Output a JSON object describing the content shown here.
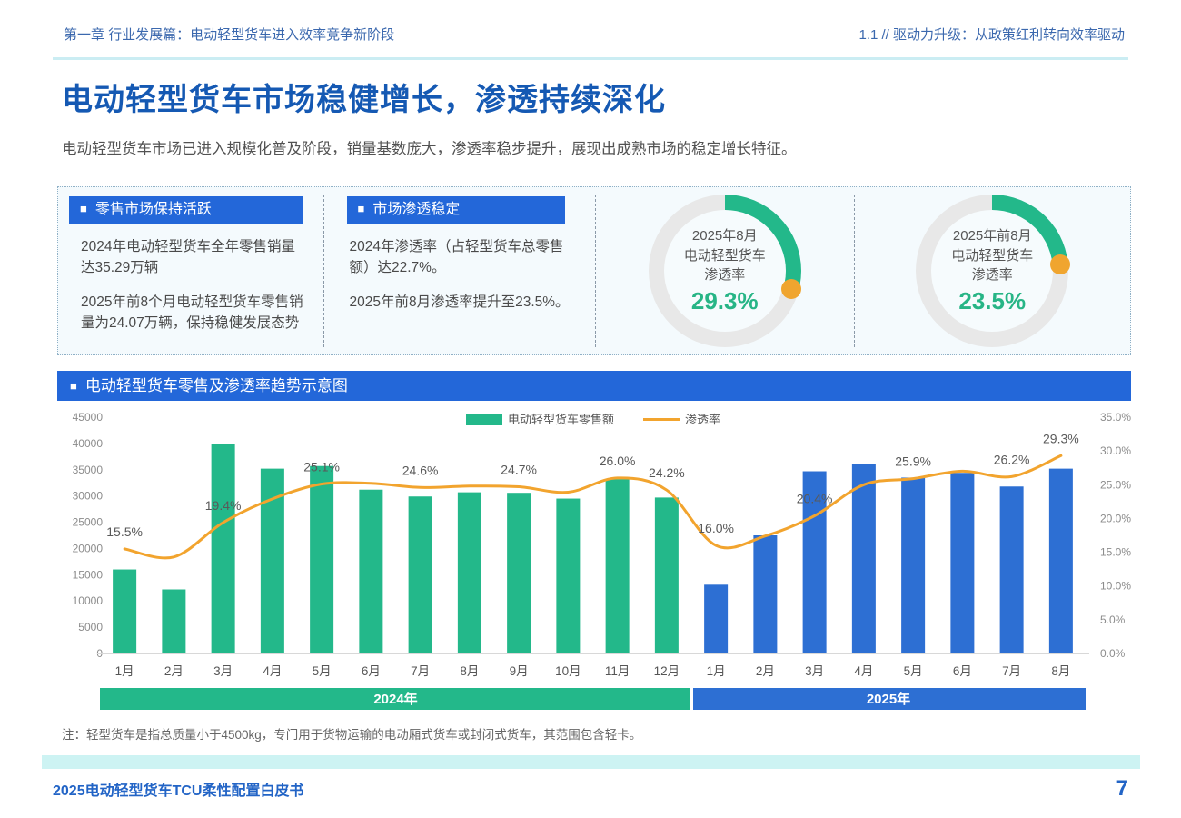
{
  "header": {
    "left": "第一章  行业发展篇：电动轻型货车进入效率竞争新阶段",
    "right": "1.1 // 驱动力升级：从政策红利转向效率驱动"
  },
  "page": {
    "title": "电动轻型货车市场稳健增长，渗透持续深化",
    "subtitle": "电动轻型货车市场已进入规模化普及阶段，销量基数庞大，渗透率稳步提升，展现出成熟市场的稳定增长特征。"
  },
  "cards": [
    {
      "bullet": "■",
      "title": "零售市场保持活跃",
      "paragraphs": [
        "2024年电动轻型货车全年零售销量达35.29万辆",
        "2025年前8个月电动轻型货车零售销量为24.07万辆，保持稳健发展态势"
      ]
    },
    {
      "bullet": "■",
      "title": "市场渗透稳定",
      "paragraphs": [
        "2024年渗透率（占轻型货车总零售额）达22.7%。",
        "2025年前8月渗透率提升至23.5%。"
      ]
    }
  ],
  "donuts": [
    {
      "label_lines": [
        "2025年8月",
        "电动轻型货车",
        "渗透率"
      ],
      "value": "29.3%",
      "percent": 29.3
    },
    {
      "label_lines": [
        "2025年前8月",
        "电动轻型货车",
        "渗透率"
      ],
      "value": "23.5%",
      "percent": 23.5
    }
  ],
  "chart_header": {
    "bullet": "■",
    "title": "电动轻型货车零售及渗透率趋势示意图"
  },
  "chart_data": {
    "type": "bar+line",
    "title": "电动轻型货车零售及渗透率趋势示意图",
    "categories": [
      "1月",
      "2月",
      "3月",
      "4月",
      "5月",
      "6月",
      "7月",
      "8月",
      "9月",
      "10月",
      "11月",
      "12月",
      "1月",
      "2月",
      "3月",
      "4月",
      "5月",
      "6月",
      "7月",
      "8月"
    ],
    "year_groups": [
      {
        "label": "2024年",
        "start": 0,
        "end": 11
      },
      {
        "label": "2025年",
        "start": 12,
        "end": 19
      }
    ],
    "series": [
      {
        "name": "电动轻型货车零售额",
        "type": "bar",
        "axis": "left",
        "values": [
          16000,
          12200,
          39900,
          35200,
          35700,
          31200,
          29900,
          30700,
          30600,
          29500,
          33200,
          29700,
          13100,
          22500,
          34700,
          36100,
          33500,
          34400,
          31800,
          35200
        ]
      },
      {
        "name": "渗透率",
        "type": "line",
        "axis": "right",
        "values": [
          15.5,
          14.3,
          19.4,
          22.9,
          25.1,
          25.2,
          24.6,
          24.8,
          24.7,
          23.9,
          26.0,
          24.2,
          16.0,
          17.4,
          20.4,
          25.0,
          25.9,
          27.0,
          26.2,
          29.3
        ]
      }
    ],
    "point_labels": {
      "0": "15.5%",
      "2": "19.4%",
      "4": "25.1%",
      "6": "24.6%",
      "8": "24.7%",
      "10": "26.0%",
      "11": "24.2%",
      "12": "16.0%",
      "14": "20.4%",
      "16": "25.9%",
      "18": "26.2%",
      "19": "29.3%"
    },
    "left_axis": {
      "min": 0,
      "max": 45000,
      "ticks": [
        "45000",
        "40000",
        "35000",
        "30000",
        "25000",
        "20000",
        "15000",
        "10000",
        "5000",
        "0"
      ]
    },
    "right_axis": {
      "min": 0,
      "max": 35,
      "ticks": [
        "35.0%",
        "30.0%",
        "25.0%",
        "20.0%",
        "15.0%",
        "10.0%",
        "5.0%",
        "0.0%"
      ]
    },
    "grid": "off",
    "legend_position": "top-center"
  },
  "note": "注：轻型货车是指总质量小于4500kg，专门用于货物运输的电动厢式货车或封闭式货车，其范围包含轻卡。",
  "footer": {
    "left": "2025电动轻型货车TCU柔性配置白皮书",
    "page": "7"
  },
  "colors": {
    "accent_blue": "#2367D9",
    "title_blue": "#1559B3",
    "header_blue": "#3B68AE",
    "bar_2024": "#23B88A",
    "bar_2025": "#2D6FD3",
    "line_orange": "#F2A42E",
    "donut_green": "#23B88A",
    "donut_track": "#E8E8E8",
    "dot_orange": "#F0A52F",
    "value_green": "#27B586",
    "band_cyan": "#CDF3F3",
    "footer_blue": "#2264C6"
  }
}
